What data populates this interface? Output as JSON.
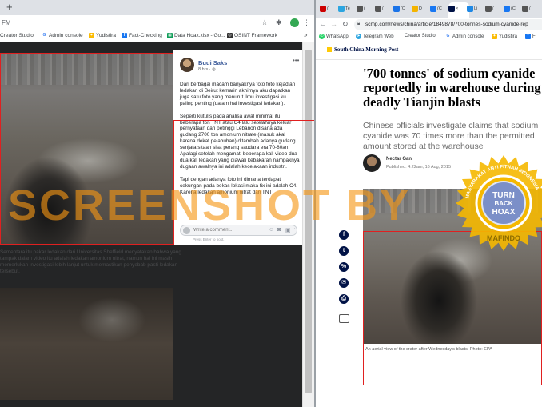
{
  "left_window": {
    "new_tab_glyph": "+",
    "address_partial": "FM",
    "bookmarks": [
      {
        "label": "Creator Studio",
        "color": "#e8e8e8"
      },
      {
        "label": "Admin console",
        "color": "#4285f4"
      },
      {
        "label": "Yudistira",
        "color": "#fbbc04"
      },
      {
        "label": "Fact-Checking",
        "color": "#1877f2"
      },
      {
        "label": "Data Hoax.xlsx - Go...",
        "color": "#0f9d58"
      },
      {
        "label": "OSINT Framework",
        "color": "#333333"
      }
    ],
    "bookmarks_overflow": "»",
    "post": {
      "author": "Budi Saks",
      "time": "8 hrs",
      "paragraphs": [
        "Dari berbagai macam banyaknya foto foto kejadian ledakan di Beirut kemarin akhirnya aku dapatkan juga satu foto yang menurut ilmu investigasi ku paling penting (dalam hal investigasi ledakan).",
        "Seperti kutulis pada analisa awal minimal itu beberapa ton TNT atau C4 lalu setelahnya keluar pernyataan dari petinggi Lebanon disana ada gudang 2700 ton amonium nitrate (masuk akal karena dekat pelabuhan) ditambah adanya gudang senjata sitaan sisa perang saudara era 70-80an. Apalagi setelah mengamati beberapa kali video dua dua kali ledakan yang diawali kebakaran nampaknya dugaan awalnya ini adalah kecelakaan industri.",
        "Tapi dengan adanya foto ini dimana terdapat cekungan pada bekas lokasi maka fix ini adalah C4. Karena ledakan amonium nitrat dan TNT"
      ],
      "comment_placeholder": "Write a comment...",
      "press_enter": "Press Enter to post."
    },
    "caption_below": "Sementara itu pakar ledakan dari Universitas Sheffield menyatakan bahwa yang tampak dalam video itu adalah ledakan amonium nitrat, namun hal ini masih memerlukan investigasi lebih lanjut untuk memastikan penyebab pasti ledakan tersebut."
  },
  "right_window": {
    "tabs": [
      {
        "label": "(",
        "color": "#cc0000"
      },
      {
        "label": "Te",
        "color": "#2ca5e0"
      },
      {
        "label": "(",
        "color": "#555555"
      },
      {
        "label": "(",
        "color": "#555555"
      },
      {
        "label": "(C",
        "color": "#1a73e8"
      },
      {
        "label": "D",
        "color": "#f4b400"
      },
      {
        "label": "(C",
        "color": "#1877f2"
      },
      {
        "label": "×",
        "color": "#001246"
      },
      {
        "label": "Li",
        "color": "#1e88e5"
      },
      {
        "label": "(",
        "color": "#555555"
      },
      {
        "label": "(C",
        "color": "#1877f2"
      },
      {
        "label": "(",
        "color": "#555555"
      }
    ],
    "url": "scmp.com/news/china/article/1849878/700-tonnes-sodium-cyanide-rep",
    "bookmarks": [
      {
        "label": "WhatsApp",
        "color": "#25d366"
      },
      {
        "label": "Telegram Web",
        "color": "#2ca5e0"
      },
      {
        "label": "Creator Studio",
        "color": "#e8e8e8"
      },
      {
        "label": "Admin console",
        "color": "#4285f4"
      },
      {
        "label": "Yudistira",
        "color": "#fbbc04"
      },
      {
        "label": "F",
        "color": "#1877f2"
      }
    ],
    "brand": "South China Morning Post",
    "headline": "'700 tonnes' of sodium cyanide reportedly in warehouse during deadly Tianjin blasts",
    "subheadline": "Chinese officials investigate claims that sodium cyanide was 70 times more than the permitted amount stored at the warehouse",
    "author": "Nectar Gan",
    "published": "Published: 4:22am, 16 Aug, 2015",
    "share_icons": [
      "f",
      "t",
      "%",
      "✉",
      "⎙"
    ],
    "photo_caption": "An aerial view of the crater after Wednesday's blasts. Photo: EPA"
  },
  "overlay": {
    "watermark": "SCREENSHOT BY",
    "seal_top_arc": "MASYARAKAT ANTI FITNAH INDONESIA",
    "seal_line1": "TURN",
    "seal_line2": "BACK",
    "seal_line3": "HOAX",
    "seal_bottom": "MAFINDO",
    "seal_color": "#f5b800",
    "seal_inner_color": "#7b8fc8"
  }
}
